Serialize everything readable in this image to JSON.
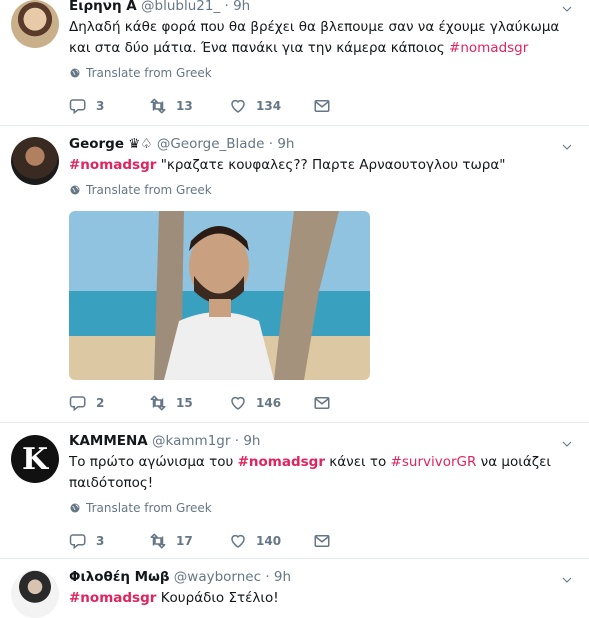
{
  "tweets": [
    {
      "name": "Ειρηνη Α",
      "handle": "@blublu21_",
      "dot": "·",
      "time": "9h",
      "text_pre": "Δηλαδή κάθε φορά που θα βρέχει θα βλεπουμε σαν να έχουμε γλαύκωμα και στα δύο μάτια. Ένα πανάκι για την κάμερα κάποιος ",
      "hashtag": "#nomadsgr",
      "translate": "Translate from Greek",
      "replies": "3",
      "retweets": "13",
      "likes": "134"
    },
    {
      "name": "George",
      "name_emoji": "♛♤",
      "handle": "@George_Blade",
      "dot": "·",
      "time": "9h",
      "hashtag": "#nomadsgr",
      "text_post": " \"κραζατε κουφαλες?? Παρτε Αρναουτογλου τωρα\"",
      "translate": "Translate from Greek",
      "replies": "2",
      "retweets": "15",
      "likes": "146"
    },
    {
      "name": "ΚΑΜΜΕΝΑ",
      "handle": "@kamm1gr",
      "dot": "·",
      "time": "9h",
      "avatar_letter": "K",
      "text_pre": "Το πρώτο αγώνισμα του ",
      "hashtag": "#nomadsgr",
      "text_mid": " κάνει το ",
      "hashtag2": "#survivorGR",
      "text_post": " να μοιάζει παιδότοπος!",
      "translate": "Translate from Greek",
      "replies": "3",
      "retweets": "17",
      "likes": "140"
    },
    {
      "name": "Φιλοθέη Μωβ",
      "handle": "@waybornec",
      "dot": "·",
      "time": "9h",
      "hashtag": "#nomadsgr",
      "text_post": " Κουράδιο Στέλιο!"
    }
  ],
  "colors": {
    "hashtag": "#e0245e",
    "secondary": "#657786",
    "border": "#e6ecf0"
  },
  "icons": [
    "reply-icon",
    "retweet-icon",
    "like-icon",
    "message-icon",
    "globe-icon",
    "chevron-down-icon"
  ]
}
